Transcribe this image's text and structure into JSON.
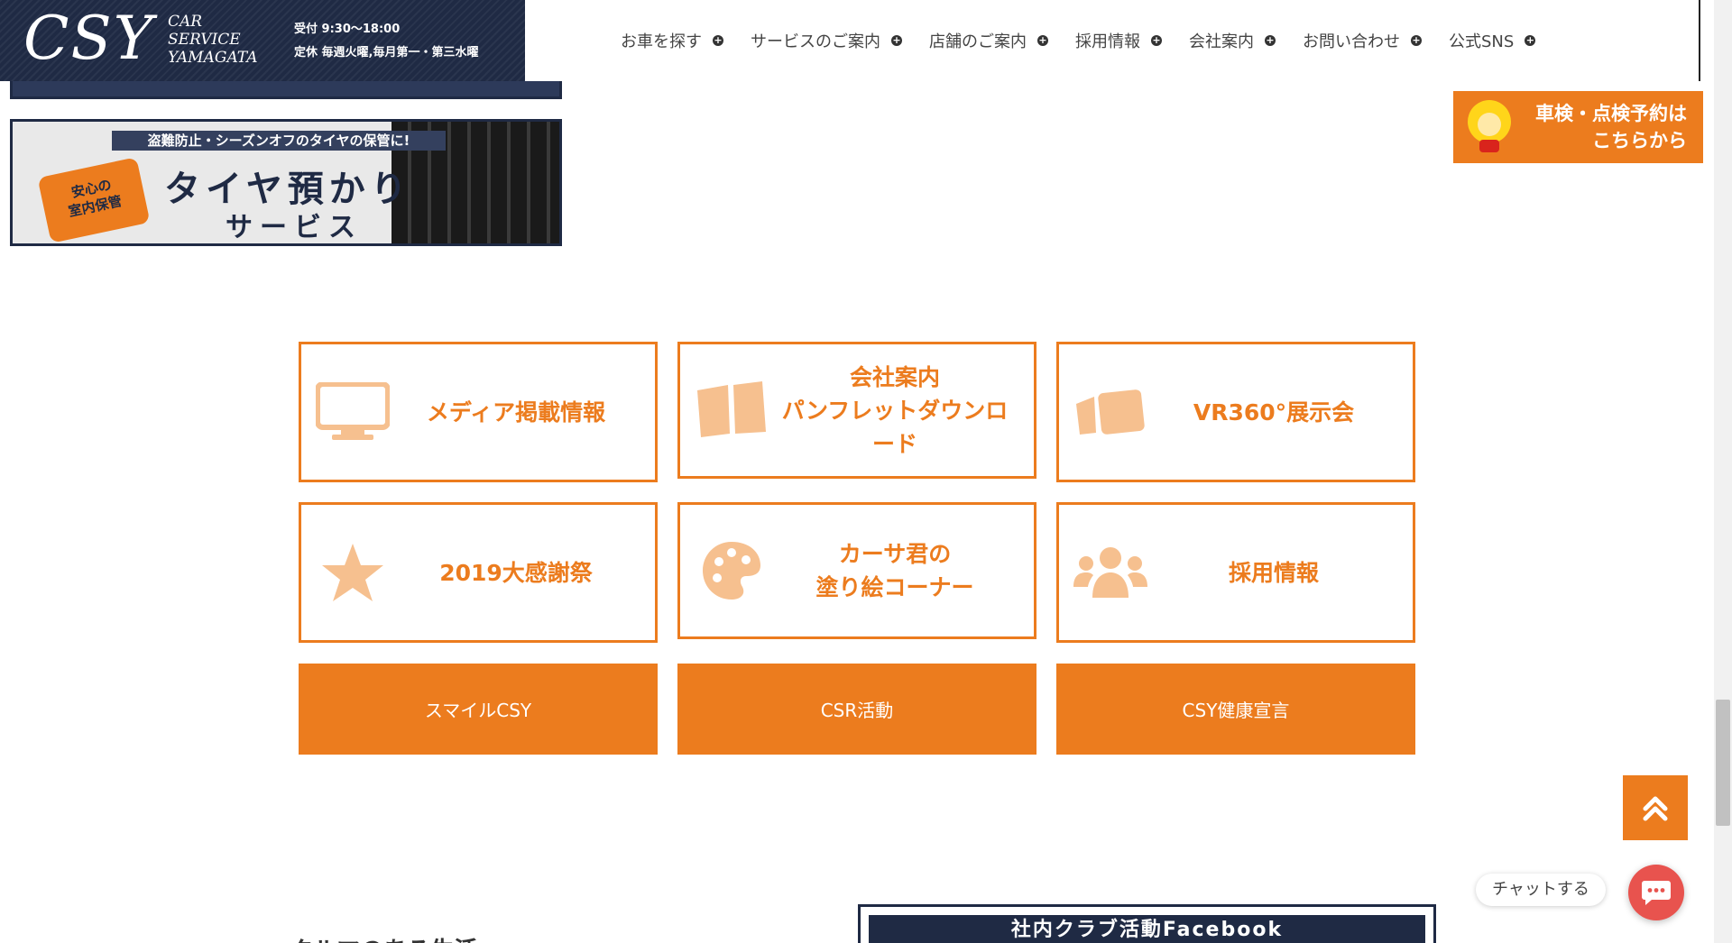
{
  "header": {
    "logo_main": "CSY",
    "logo_sub": [
      "CAR",
      "SERVICE",
      "YAMAGATA"
    ],
    "hours_line1": "受付 9:30〜18:00",
    "hours_line2": "定休 毎週火曜,毎月第一・第三水曜",
    "nav": [
      {
        "label": "お車を探す"
      },
      {
        "label": "サービスのご案内"
      },
      {
        "label": "店舗のご案内"
      },
      {
        "label": "採用情報"
      },
      {
        "label": "会社案内"
      },
      {
        "label": "お問い合わせ"
      },
      {
        "label": "公式SNS"
      }
    ]
  },
  "tire_banner": {
    "stripe": "盗難防止・シーズンオフのタイヤの保管に!",
    "badge_line1": "安心の",
    "badge_line2": "室内保管",
    "title": "タイヤ預かり",
    "subtitle": "サービス"
  },
  "reserve": {
    "line1": "車検・点検予約は",
    "line2": "こちらから"
  },
  "tiles": [
    {
      "line1": "メディア掲載情報",
      "line2": "",
      "icon": "monitor-icon"
    },
    {
      "line1": "会社案内",
      "line2": "パンフレットダウンロード",
      "icon": "book-icon"
    },
    {
      "line1": "VR360°展示会",
      "line2": "",
      "icon": "video-camera-icon"
    },
    {
      "line1": "2019大感謝祭",
      "line2": "",
      "icon": "star-icon"
    },
    {
      "line1": "カーサ君の",
      "line2": "塗り絵コーナー",
      "icon": "palette-icon"
    },
    {
      "line1": "採用情報",
      "line2": "",
      "icon": "users-icon"
    }
  ],
  "buttons": [
    {
      "label": "スマイルCSY"
    },
    {
      "label": "CSR活動"
    },
    {
      "label": "CSY健康宣言"
    }
  ],
  "bottom": {
    "left_heading": "クルマのある生活",
    "facebook_title": "社内クラブ活動Facebook"
  },
  "chat": {
    "label": "チャットする"
  },
  "colors": {
    "accent": "#ec7c1e",
    "accent_light": "#f6c08f",
    "navy": "#1f2a44",
    "chat": "#e8534e"
  }
}
